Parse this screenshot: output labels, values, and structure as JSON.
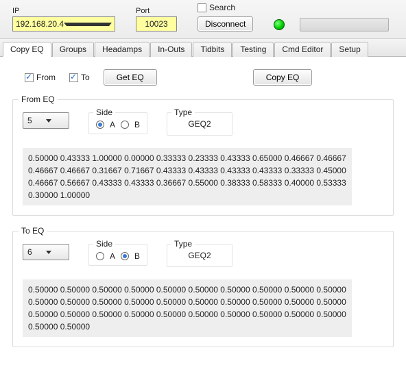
{
  "header": {
    "ip_label": "IP",
    "ip_value": "192.168.20.4",
    "port_label": "Port",
    "port_value": "10023",
    "search_label": "Search",
    "disconnect_label": "Disconnect"
  },
  "tabs": [
    {
      "label": "Copy EQ"
    },
    {
      "label": "Groups"
    },
    {
      "label": "Headamps"
    },
    {
      "label": "In-Outs"
    },
    {
      "label": "Tidbits"
    },
    {
      "label": "Testing"
    },
    {
      "label": "Cmd Editor"
    },
    {
      "label": "Setup"
    }
  ],
  "actions": {
    "from_label": "From",
    "to_label": "To",
    "geteq_label": "Get EQ",
    "copyeq_label": "Copy EQ"
  },
  "fromEq": {
    "title": "From EQ",
    "channel": "5",
    "side_label": "Side",
    "side_a": "A",
    "side_b": "B",
    "type_label": "Type",
    "type_value": "GEQ2",
    "values": "0.50000 0.43333 1.00000 0.00000 0.33333 0.23333 0.43333 0.65000 0.46667 0.46667 0.46667 0.46667 0.31667 0.71667 0.43333 0.43333 0.43333 0.43333 0.33333 0.45000 0.46667 0.56667 0.43333 0.43333 0.36667 0.55000 0.38333 0.58333 0.40000 0.53333 0.30000 1.00000"
  },
  "toEq": {
    "title": "To EQ",
    "channel": "6",
    "side_label": "Side",
    "side_a": "A",
    "side_b": "B",
    "type_label": "Type",
    "type_value": "GEQ2",
    "values": "0.50000 0.50000 0.50000 0.50000 0.50000 0.50000 0.50000 0.50000 0.50000 0.50000 0.50000 0.50000 0.50000 0.50000 0.50000 0.50000 0.50000 0.50000 0.50000 0.50000 0.50000 0.50000 0.50000 0.50000 0.50000 0.50000 0.50000 0.50000 0.50000 0.50000 0.50000 0.50000"
  }
}
